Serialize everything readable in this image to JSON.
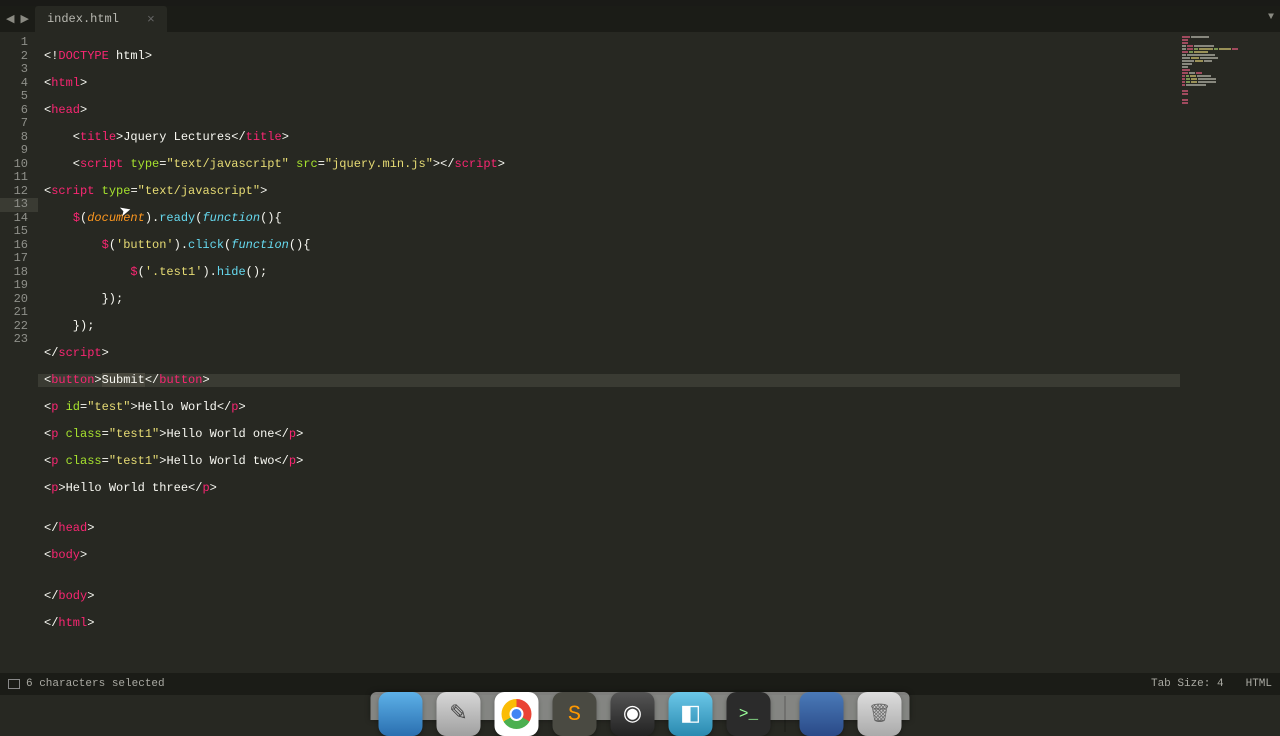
{
  "tab": {
    "filename": "index.html"
  },
  "gutter": {
    "lines": [
      "1",
      "2",
      "3",
      "4",
      "5",
      "6",
      "7",
      "8",
      "9",
      "10",
      "11",
      "12",
      "13",
      "14",
      "15",
      "16",
      "17",
      "18",
      "19",
      "20",
      "21",
      "22",
      "23"
    ],
    "active": 13
  },
  "code": {
    "l1": {
      "a": "<!",
      "b": "DOCTYPE",
      "c": " html",
      "d": ">"
    },
    "l2": {
      "a": "<",
      "b": "html",
      "c": ">"
    },
    "l3": {
      "a": "<",
      "b": "head",
      "c": ">"
    },
    "l4": {
      "a": "    <",
      "b": "title",
      "c": ">",
      "d": "Jquery Lectures",
      "e": "</",
      "f": "title",
      "g": ">"
    },
    "l5": {
      "a": "    <",
      "b": "script",
      "c": " ",
      "d": "type",
      "e": "=",
      "f": "\"text/javascript\"",
      "g": " ",
      "h": "src",
      "i": "=",
      "j": "\"jquery.min.js\"",
      "k": ">",
      "l": "</",
      "m": "script",
      "n": ">"
    },
    "l6": {
      "a": "<",
      "b": "script",
      "c": " ",
      "d": "type",
      "e": "=",
      "f": "\"text/javascript\"",
      "g": ">"
    },
    "l7": {
      "a": "    ",
      "b": "$",
      "c": "(",
      "d": "document",
      "e": ").",
      "f": "ready",
      "g": "(",
      "h": "function",
      "i": "(){"
    },
    "l8": {
      "a": "        ",
      "b": "$",
      "c": "(",
      "d": "'button'",
      "e": ").",
      "f": "click",
      "g": "(",
      "h": "function",
      "i": "(){"
    },
    "l9": {
      "a": "            ",
      "b": "$",
      "c": "(",
      "d": "'.test1'",
      "e": ").",
      "f": "hide",
      "g": "();"
    },
    "l10": {
      "a": "        });"
    },
    "l11": {
      "a": "    });"
    },
    "l12": {
      "a": "</",
      "b": "script",
      "c": ">"
    },
    "l13": {
      "a": "<",
      "b": "button",
      "c": ">",
      "d": "Submit",
      "e": "</",
      "f": "button",
      "g": ">"
    },
    "l14": {
      "a": "<",
      "b": "p",
      "c": " ",
      "d": "id",
      "e": "=",
      "f": "\"test\"",
      "g": ">",
      "h": "Hello World",
      "i": "</",
      "j": "p",
      "k": ">"
    },
    "l15": {
      "a": "<",
      "b": "p",
      "c": " ",
      "d": "class",
      "e": "=",
      "f": "\"test1\"",
      "g": ">",
      "h": "Hello World one",
      "i": "</",
      "j": "p",
      "k": ">"
    },
    "l16": {
      "a": "<",
      "b": "p",
      "c": " ",
      "d": "class",
      "e": "=",
      "f": "\"test1\"",
      "g": ">",
      "h": "Hello World two",
      "i": "</",
      "j": "p",
      "k": ">"
    },
    "l17": {
      "a": "<",
      "b": "p",
      "c": ">",
      "d": "Hello World three",
      "e": "</",
      "f": "p",
      "g": ">"
    },
    "l18": {
      "a": ""
    },
    "l19": {
      "a": "</",
      "b": "head",
      "c": ">"
    },
    "l20": {
      "a": "<",
      "b": "body",
      "c": ">"
    },
    "l21": {
      "a": ""
    },
    "l22": {
      "a": "</",
      "b": "body",
      "c": ">"
    },
    "l23": {
      "a": "</",
      "b": "html",
      "c": ">"
    }
  },
  "status": {
    "selection": "6 characters selected",
    "tabsize": "Tab Size: 4",
    "syntax": "HTML"
  }
}
